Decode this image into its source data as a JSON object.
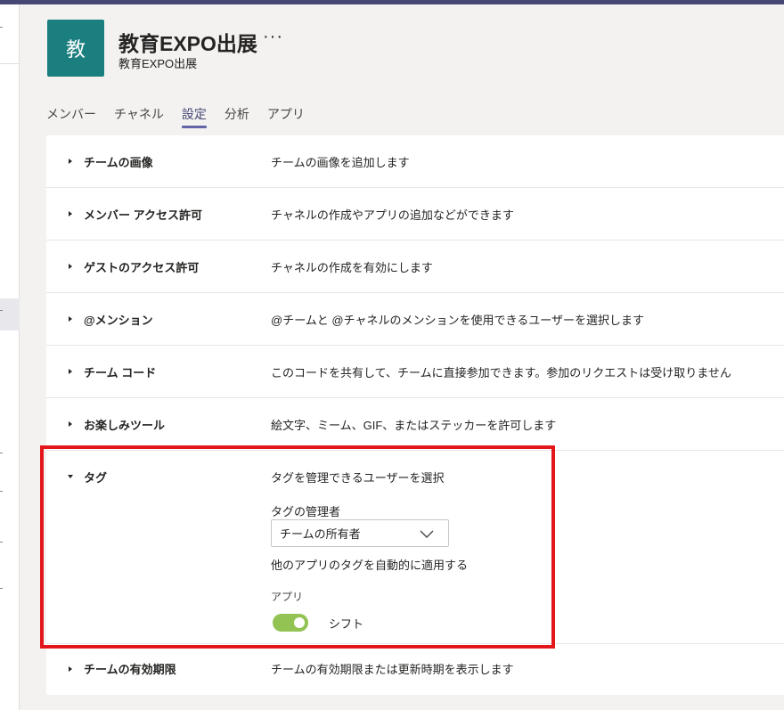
{
  "team": {
    "avatar_letter": "教",
    "title": "教育EXPO出展",
    "more": "···",
    "subtitle": "教育EXPO出展",
    "avatar_color": "#1b7f80"
  },
  "tabs": [
    {
      "label": "メンバー",
      "active": false
    },
    {
      "label": "チャネル",
      "active": false
    },
    {
      "label": "設定",
      "active": true
    },
    {
      "label": "分析",
      "active": false
    },
    {
      "label": "アプリ",
      "active": false
    }
  ],
  "settings": [
    {
      "title": "チームの画像",
      "desc": "チームの画像を追加します"
    },
    {
      "title": "メンバー アクセス許可",
      "desc": "チャネルの作成やアプリの追加などができます"
    },
    {
      "title": "ゲストのアクセス許可",
      "desc": "チャネルの作成を有効にします"
    },
    {
      "title": "@メンション",
      "desc": "@チームと @チャネルのメンションを使用できるユーザーを選択します"
    },
    {
      "title": "チーム コード",
      "desc": "このコードを共有して、チームに直接参加できます。参加のリクエストは受け取りません"
    },
    {
      "title": "お楽しみツール",
      "desc": "絵文字、ミーム、GIF、またはステッカーを許可します"
    },
    {
      "title": "タグ",
      "desc": "タグを管理できるユーザーを選択"
    },
    {
      "title": "チームの有効期限",
      "desc": "チームの有効期限または更新時期を表示します"
    }
  ],
  "tags": {
    "manager_label": "タグの管理者",
    "manager_value": "チームの所有者",
    "auto_apply_label": "他のアプリのタグを自動的に適用する",
    "app_label": "アプリ",
    "app_name": "シフト",
    "app_enabled": true
  },
  "colors": {
    "accent": "#6264a7",
    "toggle_on": "#92c353",
    "highlight": "#e3161b",
    "topbar": "#464775"
  }
}
